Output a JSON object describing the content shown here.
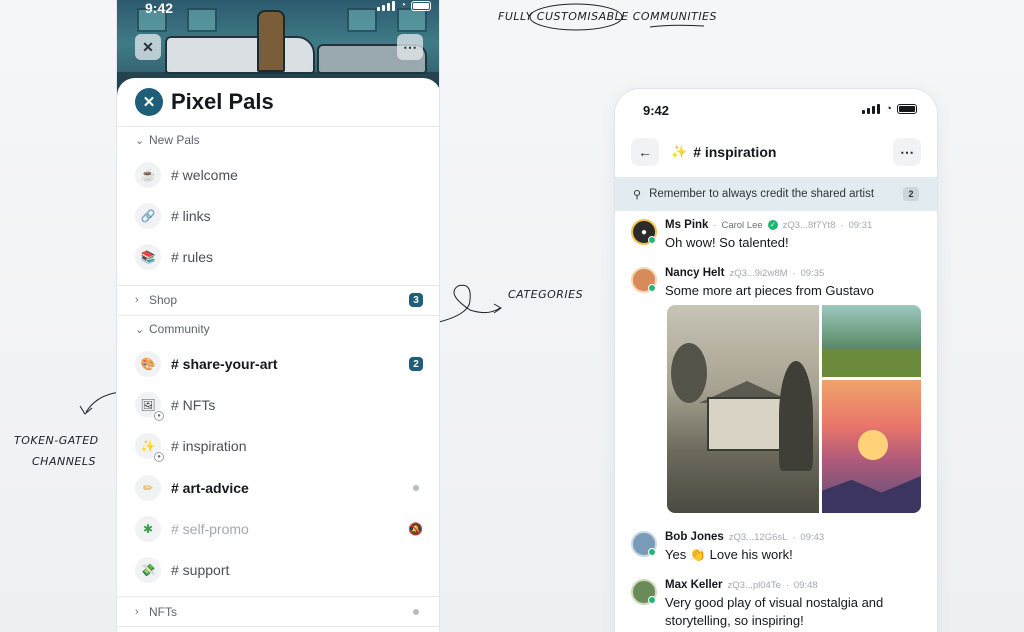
{
  "headline": "FULLY CUSTOMISABLE COMMUNITIES",
  "annotations": {
    "categories": "CATEGORIES",
    "token_gated_line1": "TOKEN-GATED",
    "token_gated_line2": "CHANNELS"
  },
  "left_phone": {
    "status_time": "9:42",
    "community_name": "Pixel Pals",
    "categories": [
      {
        "label": "New Pals",
        "expanded": true
      },
      {
        "label": "Shop",
        "expanded": false,
        "badge": "3"
      },
      {
        "label": "Community",
        "expanded": true
      },
      {
        "label": "NFTs",
        "expanded": false
      }
    ],
    "channels": [
      {
        "name": "# welcome",
        "emoji": "☕"
      },
      {
        "name": "# links",
        "emoji": "🔗"
      },
      {
        "name": "# rules",
        "emoji": "📚"
      },
      {
        "name": "# share-your-art",
        "emoji": "🎨",
        "badge": "2"
      },
      {
        "name": "# NFTs",
        "emoji": "🖼"
      },
      {
        "name": "# inspiration",
        "emoji": "✨"
      },
      {
        "name": "# art-advice",
        "emoji": "✏"
      },
      {
        "name": "# self-promo",
        "emoji": "✱"
      },
      {
        "name": "# support",
        "emoji": "💸"
      }
    ]
  },
  "right_phone": {
    "status_time": "9:42",
    "channel_title": "# inspiration",
    "channel_emoji": "✨",
    "pinned_text": "Remember to always credit the shared artist",
    "pinned_count": "2",
    "messages": [
      {
        "author": "Ms Pink",
        "sub": "Carol Lee",
        "address": "zQ3...8f7Yt8",
        "time": "09:31",
        "text": "Oh wow! So talented!"
      },
      {
        "author": "Nancy Helt",
        "address": "zQ3...9i2w8M",
        "time": "09:35",
        "text": "Some more art pieces from Gustavo"
      },
      {
        "author": "Bob Jones",
        "address": "zQ3...12G6sL",
        "time": "09:43",
        "text": "Yes 👏 Love his work!"
      },
      {
        "author": "Max Keller",
        "address": "zQ3...pl04Te",
        "time": "09:48",
        "text": "Very good play of visual nostalgia and storytelling, so inspiring!"
      }
    ]
  },
  "colors": {
    "accent": "#1f5e79",
    "online": "#22b573",
    "pinned_bg": "#e2ebf0"
  }
}
